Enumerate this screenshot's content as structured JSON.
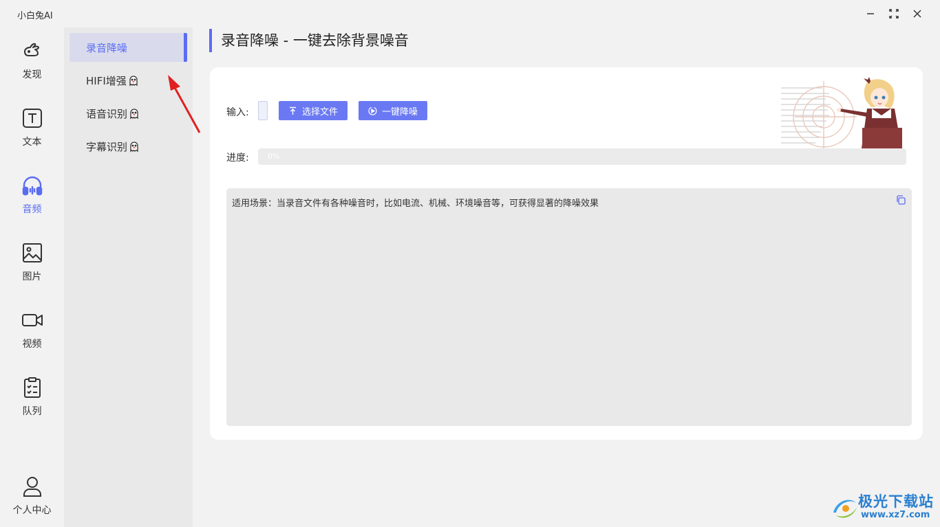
{
  "app": {
    "title": "小白兔AI"
  },
  "colors": {
    "accent": "#5b6cf2",
    "button": "#6a79f3",
    "annotation_arrow": "#e02020"
  },
  "nav": {
    "items": [
      {
        "label": "发现",
        "icon": "bunny-icon",
        "active": false
      },
      {
        "label": "文本",
        "icon": "text-icon",
        "active": false
      },
      {
        "label": "音频",
        "icon": "headphones-icon",
        "active": true
      },
      {
        "label": "图片",
        "icon": "image-icon",
        "active": false
      },
      {
        "label": "视频",
        "icon": "video-camera-icon",
        "active": false
      },
      {
        "label": "队列",
        "icon": "clipboard-checklist-icon",
        "active": false
      }
    ],
    "profile": {
      "label": "个人中心",
      "icon": "user-icon"
    }
  },
  "subnav": {
    "items": [
      {
        "label": "录音降噪",
        "active": true,
        "badge": false
      },
      {
        "label": "HIFI增强",
        "active": false,
        "badge": true
      },
      {
        "label": "语音识别",
        "active": false,
        "badge": true
      },
      {
        "label": "字幕识别",
        "active": false,
        "badge": true
      }
    ]
  },
  "main": {
    "title": "录音降噪 - 一键去除背景噪音",
    "input_label": "输入:",
    "select_file_button": "选择文件",
    "denoise_button": "一键降噪",
    "progress_label": "进度:",
    "progress_value": 0,
    "progress_text": "0%",
    "description": "适用场景：当录音文件有各种噪音时，比如电流、机械、环境噪音等，可获得显著的降噪效果"
  },
  "watermark": {
    "name": "极光下载站",
    "url": "www.xz7.com"
  }
}
